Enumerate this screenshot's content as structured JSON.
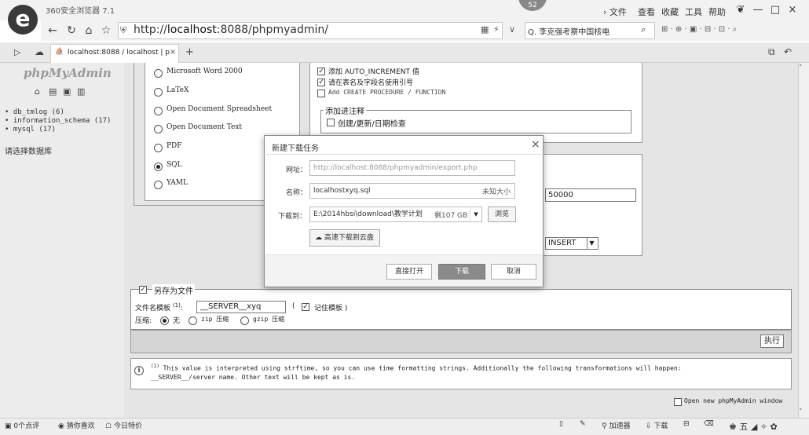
{
  "browser": {
    "logo_glyph": "e",
    "title": "360安全浏览器 7.1",
    "badge": "52",
    "menu": [
      "› 文件",
      "查看",
      "收藏",
      "工具",
      "帮助"
    ],
    "window_controls": [
      "—",
      "□",
      "×"
    ],
    "address": "http://localhost:8088/phpmyadmin/",
    "address_host": "localhost",
    "address_prefix": "http://",
    "address_suffix": ":8088/phpmyadmin/",
    "search_text": "Q. 李克强考察中国核电",
    "tab_title": "localhost:8088 / localhost | p",
    "tab_close": "×",
    "new_tab": "+"
  },
  "sidebar": {
    "logo_a": "php",
    "logo_b": "MyAdmin",
    "databases": [
      "db_tmlog (6)",
      "information_schema (17)",
      "mysql (17)"
    ],
    "select_db": "请选择数据库"
  },
  "formats": [
    {
      "label": "Microsoft Word 2000",
      "selected": false
    },
    {
      "label": "LaTeX",
      "selected": false
    },
    {
      "label": "Open Document Spreadsheet",
      "selected": false
    },
    {
      "label": "Open Document Text",
      "selected": false
    },
    {
      "label": "PDF",
      "selected": false
    },
    {
      "label": "SQL",
      "selected": true
    },
    {
      "label": "YAML",
      "selected": false
    }
  ],
  "options": {
    "auto_increment": "添加 AUTO_INCREMENT 值",
    "quote_names": "请在表名及字段名使用引号",
    "create_proc": "Add CREATE PROCEDURE / FUNCTION",
    "comments_legend": "添加进注释",
    "comments_item": "创建/更新/日期检查",
    "max_value": "50000",
    "insert_type": "INSERT"
  },
  "save_file": {
    "legend": "另存为文件",
    "template_label": "文件名模板",
    "template_sup": "(1)",
    "template_value": "__SERVER__xyq",
    "remember": "记住模板",
    "compression_label": "压缩:",
    "compression": [
      {
        "label": "无",
        "selected": true
      },
      {
        "label": "zip 压缩",
        "selected": false
      },
      {
        "label": "gzip 压缩",
        "selected": false
      }
    ],
    "go_button": "执行"
  },
  "footnote": {
    "sup": "(1)",
    "line1": "This value is interpreted using strftime, so you can use time formatting strings. Additionally the following transformations will happen:",
    "line2": "__SERVER__/server name. Other text will be kept as is."
  },
  "open_new_window": "Open new phpMyAdmin window",
  "dialog": {
    "title": "新建下载任务",
    "close": "×",
    "url_label": "网址：",
    "url_value": "http://localhost:8088/phpmyadmin/export.php",
    "name_label": "名称：",
    "name_value": "localhostxyq.sql",
    "size_text": "未知大小",
    "dest_label": "下载到：",
    "dest_value": "E:\\2014hbsi\\download\\教学计划",
    "free_space": "剩107 GB",
    "browse": "浏览",
    "cloud": "高速下载到云盘",
    "open_direct": "直接打开",
    "download": "下载",
    "cancel": "取消"
  },
  "statusbar": {
    "left1": "0个点评",
    "left2": "猜你喜欢",
    "left3": "今日特价",
    "accel": "加速器",
    "download": "下载"
  }
}
